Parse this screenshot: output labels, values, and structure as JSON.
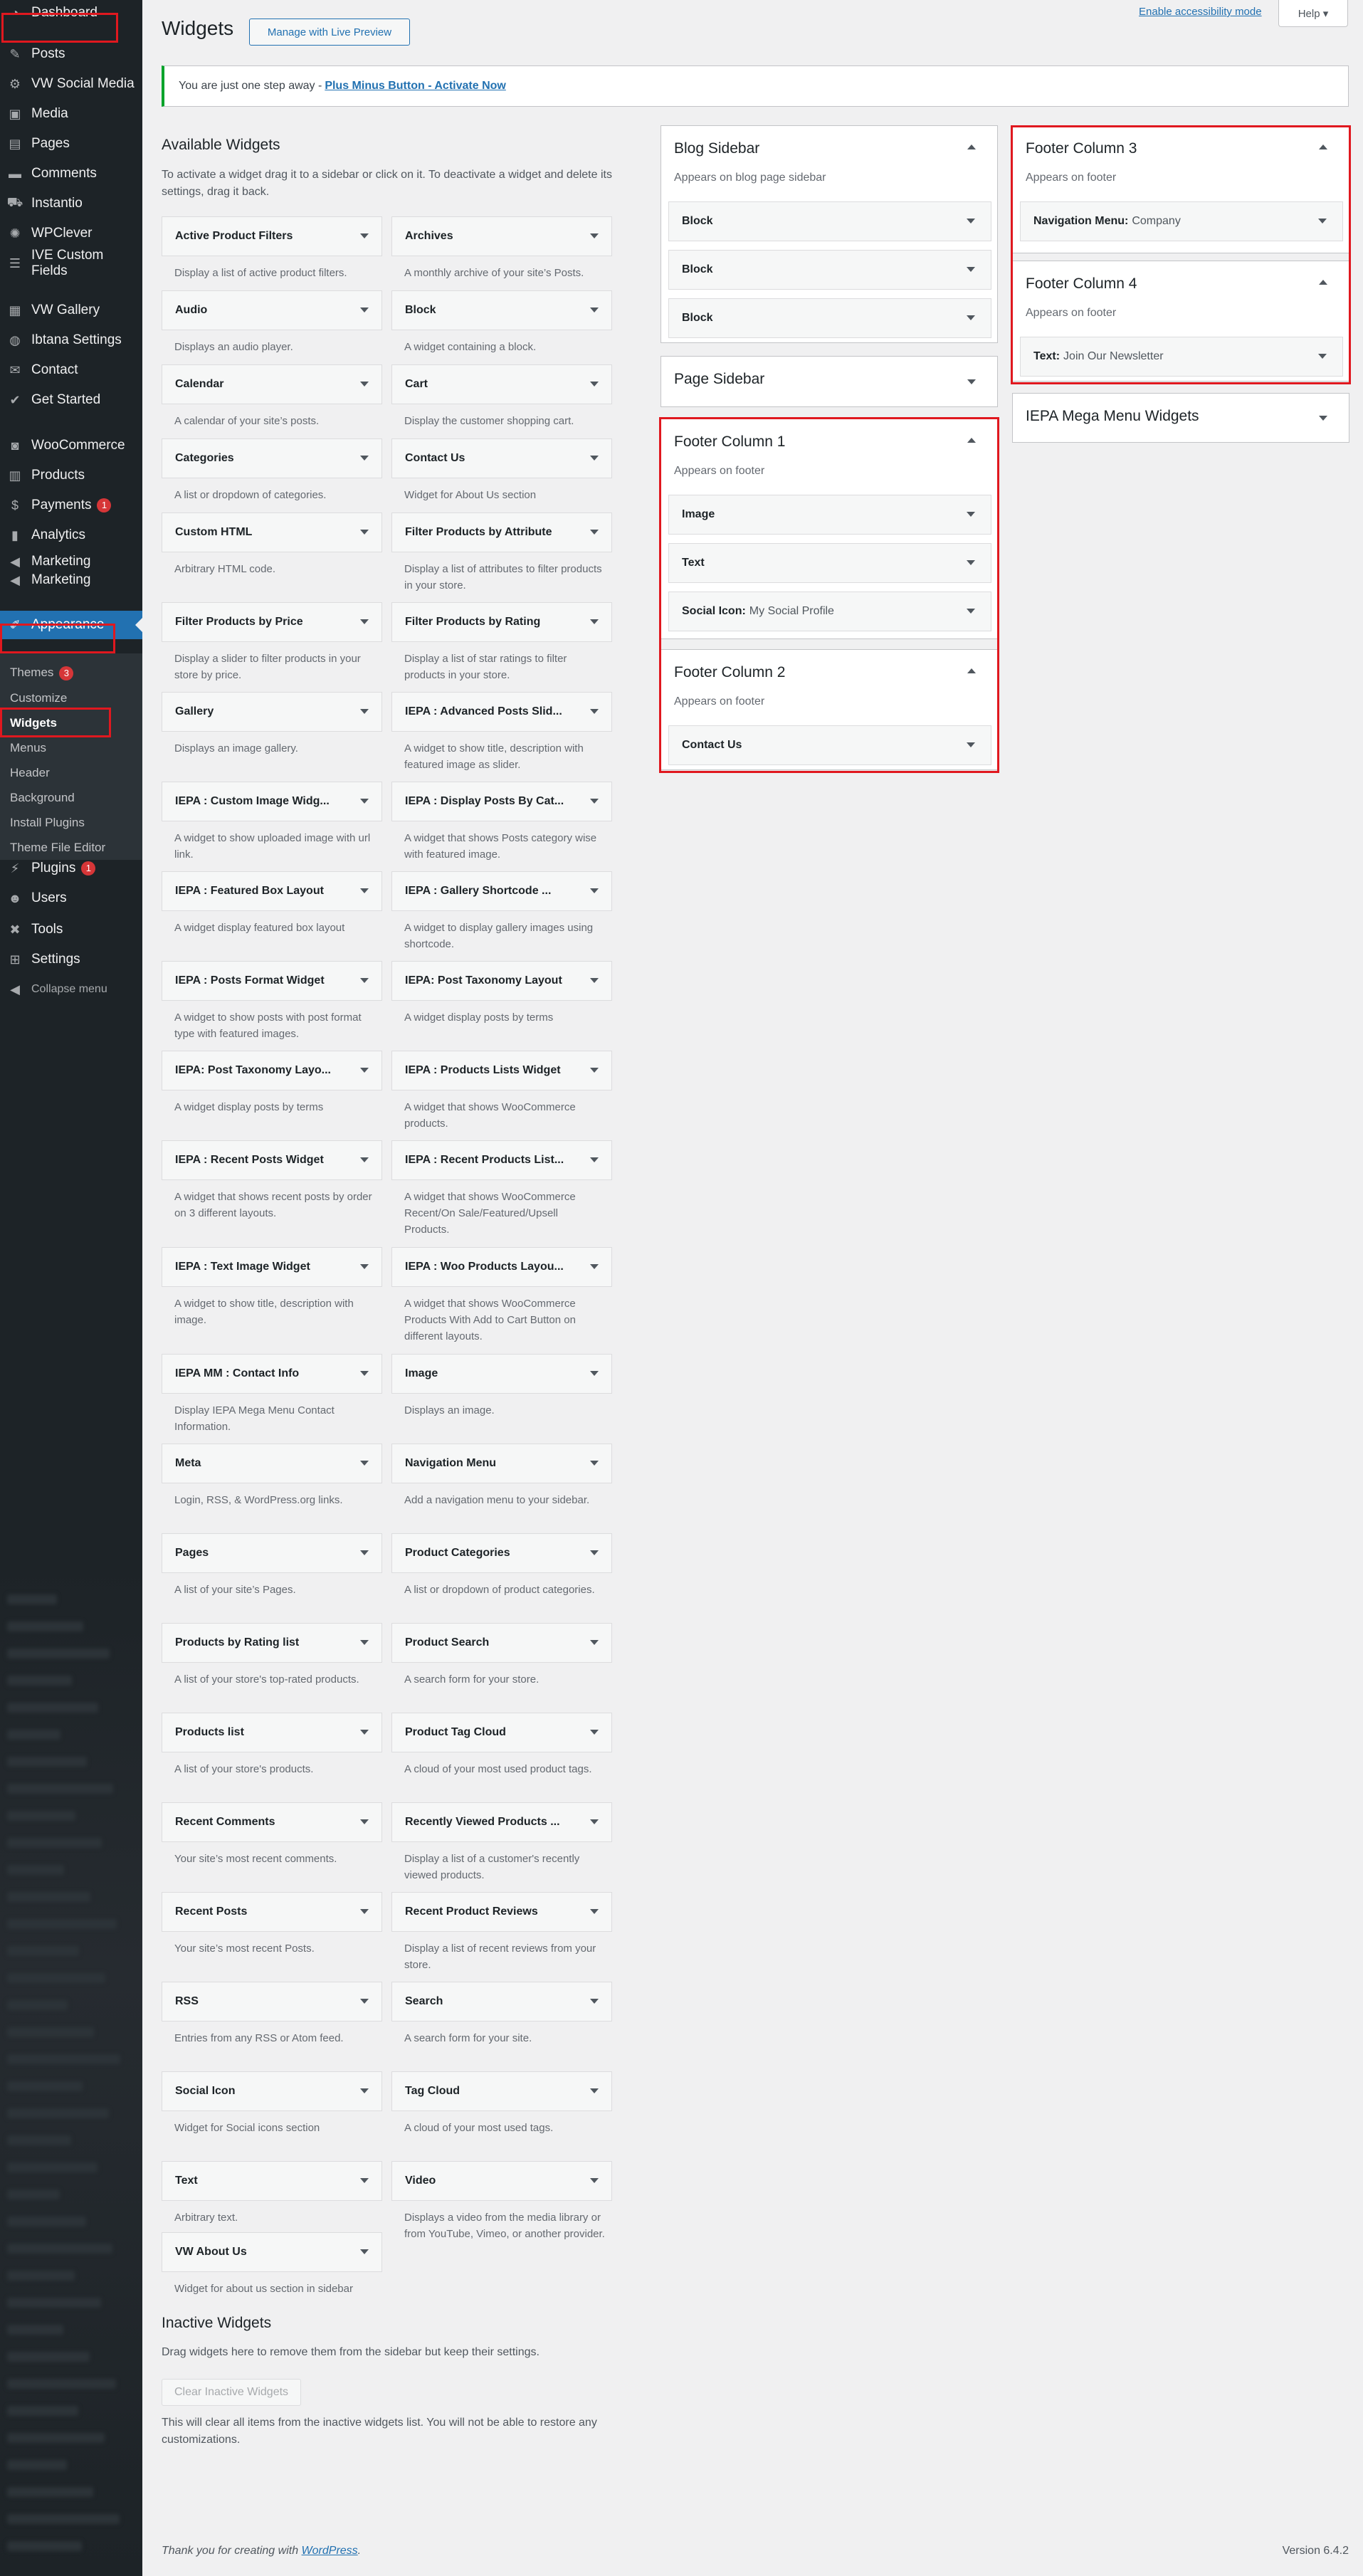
{
  "sidebar": {
    "items": [
      {
        "id": "dashboard",
        "label": "Dashboard",
        "icon": "dashboard-icon",
        "glyph": "◔"
      },
      {
        "id": "posts",
        "label": "Posts",
        "icon": "pin-icon",
        "glyph": "✎"
      },
      {
        "id": "vw-social",
        "label": "VW Social Media",
        "icon": "gear-icon",
        "glyph": "⚙"
      },
      {
        "id": "media",
        "label": "Media",
        "icon": "media-icon",
        "glyph": "▣"
      },
      {
        "id": "pages",
        "label": "Pages",
        "icon": "page-icon",
        "glyph": "▤"
      },
      {
        "id": "comments",
        "label": "Comments",
        "icon": "comment-icon",
        "glyph": "▬"
      },
      {
        "id": "instantio",
        "label": "Instantio",
        "icon": "cart-icon",
        "glyph": "⛟"
      },
      {
        "id": "wpclever",
        "label": "WPClever",
        "icon": "lightbulb-icon",
        "glyph": "✺"
      },
      {
        "id": "ive-custom",
        "label": "IVE Custom",
        "label2": "Fields",
        "icon": "fields-icon",
        "glyph": "☰"
      },
      {
        "id": "vw-gallery",
        "label": "VW Gallery",
        "icon": "gallery-icon",
        "glyph": "▦"
      },
      {
        "id": "ibtana",
        "label": "Ibtana Settings",
        "icon": "settings-icon",
        "glyph": "◍"
      },
      {
        "id": "contact",
        "label": "Contact",
        "icon": "mail-icon",
        "glyph": "✉"
      },
      {
        "id": "get-started",
        "label": "Get Started",
        "icon": "chevron-icon",
        "glyph": "✔"
      },
      {
        "id": "woocommerce",
        "label": "WooCommerce",
        "icon": "woo-icon",
        "glyph": "◙"
      },
      {
        "id": "products",
        "label": "Products",
        "icon": "products-icon",
        "glyph": "▥"
      },
      {
        "id": "payments",
        "label": "Payments",
        "icon": "dollar-icon",
        "glyph": "$",
        "badge": "1"
      },
      {
        "id": "analytics",
        "label": "Analytics",
        "icon": "chart-icon",
        "glyph": "▮"
      },
      {
        "id": "marketing1",
        "label": "Marketing",
        "icon": "megaphone-icon",
        "glyph": "◀"
      },
      {
        "id": "marketing2",
        "label": "Marketing",
        "icon": "megaphone-icon",
        "glyph": "◀"
      },
      {
        "id": "appearance",
        "label": "Appearance",
        "icon": "brush-icon",
        "glyph": "✐",
        "active": true
      },
      {
        "id": "plugins",
        "label": "Plugins",
        "icon": "plugin-icon",
        "glyph": "⚡",
        "badge": "1"
      },
      {
        "id": "users",
        "label": "Users",
        "icon": "user-icon",
        "glyph": "☻"
      },
      {
        "id": "tools",
        "label": "Tools",
        "icon": "wrench-icon",
        "glyph": "✖"
      },
      {
        "id": "settings",
        "label": "Settings",
        "icon": "sliders-icon",
        "glyph": "⊞"
      },
      {
        "id": "collapse",
        "label": "Collapse menu",
        "icon": "collapse-icon",
        "glyph": "◀"
      }
    ],
    "submenu": [
      {
        "label": "Themes",
        "badge": "3"
      },
      {
        "label": "Customize"
      },
      {
        "label": "Widgets",
        "current": true
      },
      {
        "label": "Menus"
      },
      {
        "label": "Header"
      },
      {
        "label": "Background"
      },
      {
        "label": "Install Plugins"
      },
      {
        "label": "Theme File Editor"
      }
    ]
  },
  "header": {
    "title": "Widgets",
    "live_preview": "Manage with Live Preview",
    "accessibility": "Enable accessibility mode",
    "help": "Help ▾"
  },
  "notice": {
    "text": "You are just one step away -",
    "link": "Plus Minus Button - Activate Now"
  },
  "available": {
    "title": "Available Widgets",
    "desc": "To activate a widget drag it to a sidebar or click on it. To deactivate a widget and delete its settings, drag it back.",
    "widgets": [
      {
        "name": "Active Product Filters",
        "desc": "Display a list of active product filters."
      },
      {
        "name": "Archives",
        "desc": "A monthly archive of your site’s Posts."
      },
      {
        "name": "Audio",
        "desc": "Displays an audio player."
      },
      {
        "name": "Block",
        "desc": "A widget containing a block."
      },
      {
        "name": "Calendar",
        "desc": "A calendar of your site’s posts."
      },
      {
        "name": "Cart",
        "desc": "Display the customer shopping cart."
      },
      {
        "name": "Categories",
        "desc": "A list or dropdown of categories."
      },
      {
        "name": "Contact Us",
        "desc": "Widget for About Us section"
      },
      {
        "name": "Custom HTML",
        "desc": "Arbitrary HTML code."
      },
      {
        "name": "Filter Products by Attribute",
        "desc": "Display a list of attributes to filter products in your store."
      },
      {
        "name": "Filter Products by Price",
        "desc": "Display a slider to filter products in your store by price."
      },
      {
        "name": "Filter Products by Rating",
        "desc": "Display a list of star ratings to filter products in your store."
      },
      {
        "name": "Gallery",
        "desc": "Displays an image gallery."
      },
      {
        "name": "IEPA : Advanced Posts Slid...",
        "desc": "A widget to show title, description with featured image as slider."
      },
      {
        "name": "IEPA : Custom Image Widg...",
        "desc": "A widget to show uploaded image with url link."
      },
      {
        "name": "IEPA : Display Posts By Cat...",
        "desc": "A widget that shows Posts category wise with featured image."
      },
      {
        "name": "IEPA : Featured Box Layout",
        "desc": "A widget display featured box layout"
      },
      {
        "name": "IEPA : Gallery Shortcode ...",
        "desc": "A widget to display gallery images using shortcode."
      },
      {
        "name": "IEPA : Posts Format Widget",
        "desc": "A widget to show posts with post format type with featured images."
      },
      {
        "name": "IEPA: Post Taxonomy Layout",
        "desc": "A widget display posts by terms"
      },
      {
        "name": "IEPA: Post Taxonomy Layo...",
        "desc": "A widget display posts by terms"
      },
      {
        "name": "IEPA : Products Lists Widget",
        "desc": "A widget that shows WooCommerce products."
      },
      {
        "name": "IEPA : Recent Posts Widget",
        "desc": "A widget that shows recent posts by order on 3 different layouts."
      },
      {
        "name": "IEPA : Recent Products List...",
        "desc": "A widget that shows WooCommerce Recent/On Sale/Featured/Upsell Products."
      },
      {
        "name": "IEPA : Text Image Widget",
        "desc": "A widget to show title, description with image."
      },
      {
        "name": "IEPA : Woo Products Layou...",
        "desc": "A widget that shows WooCommerce Products With Add to Cart Button on different layouts."
      },
      {
        "name": "IEPA MM : Contact Info",
        "desc": "Display IEPA Mega Menu Contact Information."
      },
      {
        "name": "Image",
        "desc": "Displays an image."
      },
      {
        "name": "Meta",
        "desc": "Login, RSS, & WordPress.org links."
      },
      {
        "name": "Navigation Menu",
        "desc": "Add a navigation menu to your sidebar."
      },
      {
        "name": "Pages",
        "desc": "A list of your site’s Pages."
      },
      {
        "name": "Product Categories",
        "desc": "A list or dropdown of product categories."
      },
      {
        "name": "Products by Rating list",
        "desc": "A list of your store's top-rated products."
      },
      {
        "name": "Product Search",
        "desc": "A search form for your store."
      },
      {
        "name": "Products list",
        "desc": "A list of your store's products."
      },
      {
        "name": "Product Tag Cloud",
        "desc": "A cloud of your most used product tags."
      },
      {
        "name": "Recent Comments",
        "desc": "Your site’s most recent comments."
      },
      {
        "name": "Recently Viewed Products ...",
        "desc": "Display a list of a customer's recently viewed products."
      },
      {
        "name": "Recent Posts",
        "desc": "Your site’s most recent Posts."
      },
      {
        "name": "Recent Product Reviews",
        "desc": "Display a list of recent reviews from your store."
      },
      {
        "name": "RSS",
        "desc": "Entries from any RSS or Atom feed."
      },
      {
        "name": "Search",
        "desc": "A search form for your site."
      },
      {
        "name": "Social Icon",
        "desc": "Widget for Social icons section"
      },
      {
        "name": "Tag Cloud",
        "desc": "A cloud of your most used tags."
      },
      {
        "name": "Text",
        "desc": "Arbitrary text."
      },
      {
        "name": "Video",
        "desc": "Displays a video from the media library or from YouTube, Vimeo, or another provider."
      },
      {
        "name": "VW About Us",
        "desc": "Widget for about us section in sidebar"
      }
    ]
  },
  "sidebars": {
    "blog": {
      "title": "Blog Sidebar",
      "desc": "Appears on blog page sidebar",
      "widgets": [
        "Block",
        "Block",
        "Block"
      ]
    },
    "page": {
      "title": "Page Sidebar"
    },
    "footer1": {
      "title": "Footer Column 1",
      "desc": "Appears on footer",
      "widgets": [
        {
          "t": "Image",
          "s": ""
        },
        {
          "t": "Text",
          "s": ""
        },
        {
          "t": "Social Icon:",
          "s": "My Social Profile"
        }
      ]
    },
    "footer2": {
      "title": "Footer Column 2",
      "desc": "Appears on footer",
      "widgets": [
        {
          "t": "Contact Us",
          "s": ""
        }
      ]
    },
    "footer3": {
      "title": "Footer Column 3",
      "desc": "Appears on footer",
      "widgets": [
        {
          "t": "Navigation Menu:",
          "s": "Company"
        }
      ]
    },
    "footer4": {
      "title": "Footer Column 4",
      "desc": "Appears on footer",
      "widgets": [
        {
          "t": "Text:",
          "s": "Join Our Newsletter"
        }
      ]
    },
    "mega": {
      "title": "IEPA Mega Menu Widgets"
    }
  },
  "inactive": {
    "title": "Inactive Widgets",
    "desc": "Drag widgets here to remove them from the sidebar but keep their settings.",
    "clear": "Clear Inactive Widgets",
    "note": "This will clear all items from the inactive widgets list. You will not be able to restore any customizations."
  },
  "footer": {
    "thanks": "Thank you for creating with",
    "link": "WordPress",
    "suffix": ".",
    "version": "Version 6.4.2"
  },
  "colors": {
    "highlight": "#e0181f",
    "accent": "#2271b1",
    "menu_bg": "#1d2327",
    "notice_border": "#00a32a",
    "badge": "#d63638"
  }
}
